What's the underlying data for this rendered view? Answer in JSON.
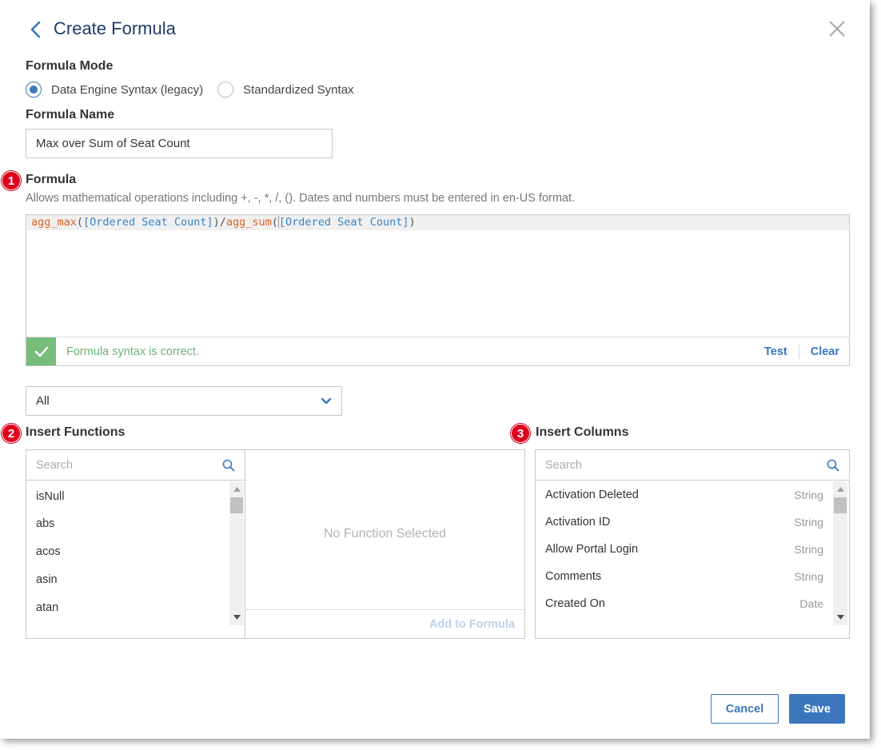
{
  "header": {
    "title": "Create Formula"
  },
  "formula_mode": {
    "label": "Formula Mode",
    "options": [
      {
        "label": "Data Engine Syntax (legacy)",
        "checked": true
      },
      {
        "label": "Standardized Syntax",
        "checked": false
      }
    ]
  },
  "formula_name": {
    "label": "Formula Name",
    "value": "Max over Sum of Seat Count"
  },
  "formula": {
    "badge": "1",
    "label": "Formula",
    "helper": "Allows mathematical operations including +, -, *, /, (). Dates and numbers must be entered in en-US format.",
    "tokens": {
      "fn1": "agg_max",
      "open1": "(",
      "col1": "[Ordered Seat Count]",
      "close1": ")/",
      "fn2": "agg_sum",
      "open2": "(",
      "col2": "[Ordered Seat Count]",
      "close2": ")"
    },
    "status": "Formula syntax is correct.",
    "test_label": "Test",
    "clear_label": "Clear",
    "status_color": "#78bd7c"
  },
  "category_select": {
    "value": "All"
  },
  "insert_functions": {
    "badge": "2",
    "label": "Insert Functions",
    "search_placeholder": "Search",
    "items": [
      "isNull",
      "abs",
      "acos",
      "asin",
      "atan"
    ],
    "empty_text": "No Function Selected",
    "add_label": "Add to Formula"
  },
  "insert_columns": {
    "badge": "3",
    "label": "Insert Columns",
    "search_placeholder": "Search",
    "items": [
      {
        "name": "Activation Deleted",
        "type": "String"
      },
      {
        "name": "Activation ID",
        "type": "String"
      },
      {
        "name": "Allow Portal Login",
        "type": "String"
      },
      {
        "name": "Comments",
        "type": "String"
      },
      {
        "name": "Created On",
        "type": "Date"
      }
    ]
  },
  "footer": {
    "cancel_label": "Cancel",
    "save_label": "Save"
  },
  "colors": {
    "accent": "#3b76bd",
    "title": "#1f3c66",
    "badge": "#e0001b",
    "success": "#6bb36f"
  }
}
